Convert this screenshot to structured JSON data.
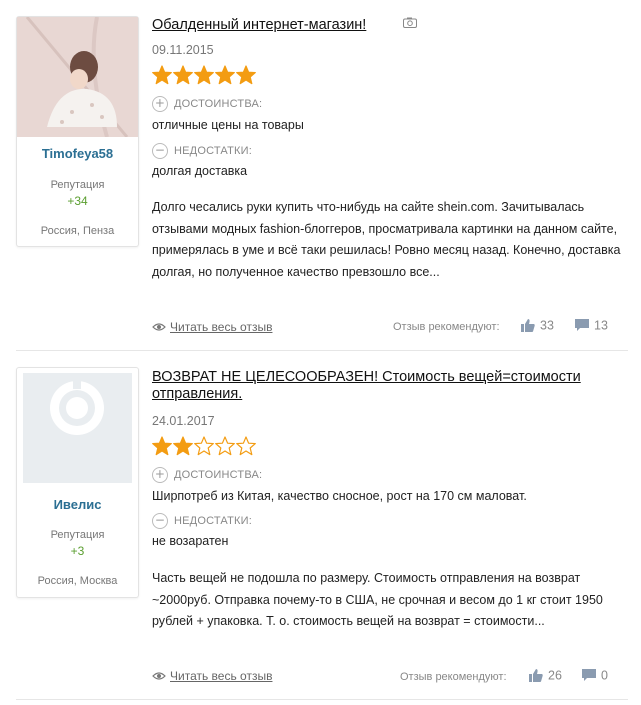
{
  "reviews": [
    {
      "title": "Обалденный интернет-магазин!",
      "date": "09.11.2015",
      "rating": 5,
      "author": {
        "name": "Timofeya58",
        "reputation_label": "Репутация",
        "reputation_value": "+34",
        "location": "Россия, Пенза"
      },
      "pros_label": "ДОСТОИНСТВА:",
      "pros": "отличные цены на товары",
      "cons_label": "НЕДОСТАТКИ:",
      "cons": "долгая доставка",
      "body": "Долго чесались руки купить что-нибудь на сайте shein.com. Зачитывалась отзывами модных fashion-блоггеров, просматривала картинки на данном сайте, примерялась в уме и всё таки решилась! Ровно месяц назад. Конечно, доставка долгая, но полученное качество превзошло все...",
      "read_more": "Читать весь отзыв",
      "recommend_label": "Отзыв рекомендуют:",
      "likes": "33",
      "comments": "13"
    },
    {
      "title": "ВОЗВРАТ НЕ ЦЕЛЕСООБРАЗЕН! Стоимость вещей=стоимости отправления.",
      "date": "24.01.2017",
      "rating": 2,
      "author": {
        "name": "Ивелис",
        "reputation_label": "Репутация",
        "reputation_value": "+3",
        "location": "Россия, Москва"
      },
      "pros_label": "ДОСТОИНСТВА:",
      "pros": "Ширпотреб из Китая, качество сносное, рост на 170 см маловат.",
      "cons_label": "НЕДОСТАТКИ:",
      "cons": "не возаратен",
      "body": "Часть вещей не подошла по размеру. Стоимость отправления на возврат ~2000руб. Отправка почему-то в США, не срочная и весом до 1 кг стоит 1950 рублей + упаковка. Т. о. стоимость вещей на возврат = стоимости...",
      "read_more": "Читать весь отзыв",
      "recommend_label": "Отзыв рекомендуют:",
      "likes": "26",
      "comments": "0"
    }
  ],
  "colors": {
    "star": "#f39c12",
    "author_name": "#2b6f93",
    "reputation": "#5a9e2f",
    "muted": "#888888"
  }
}
